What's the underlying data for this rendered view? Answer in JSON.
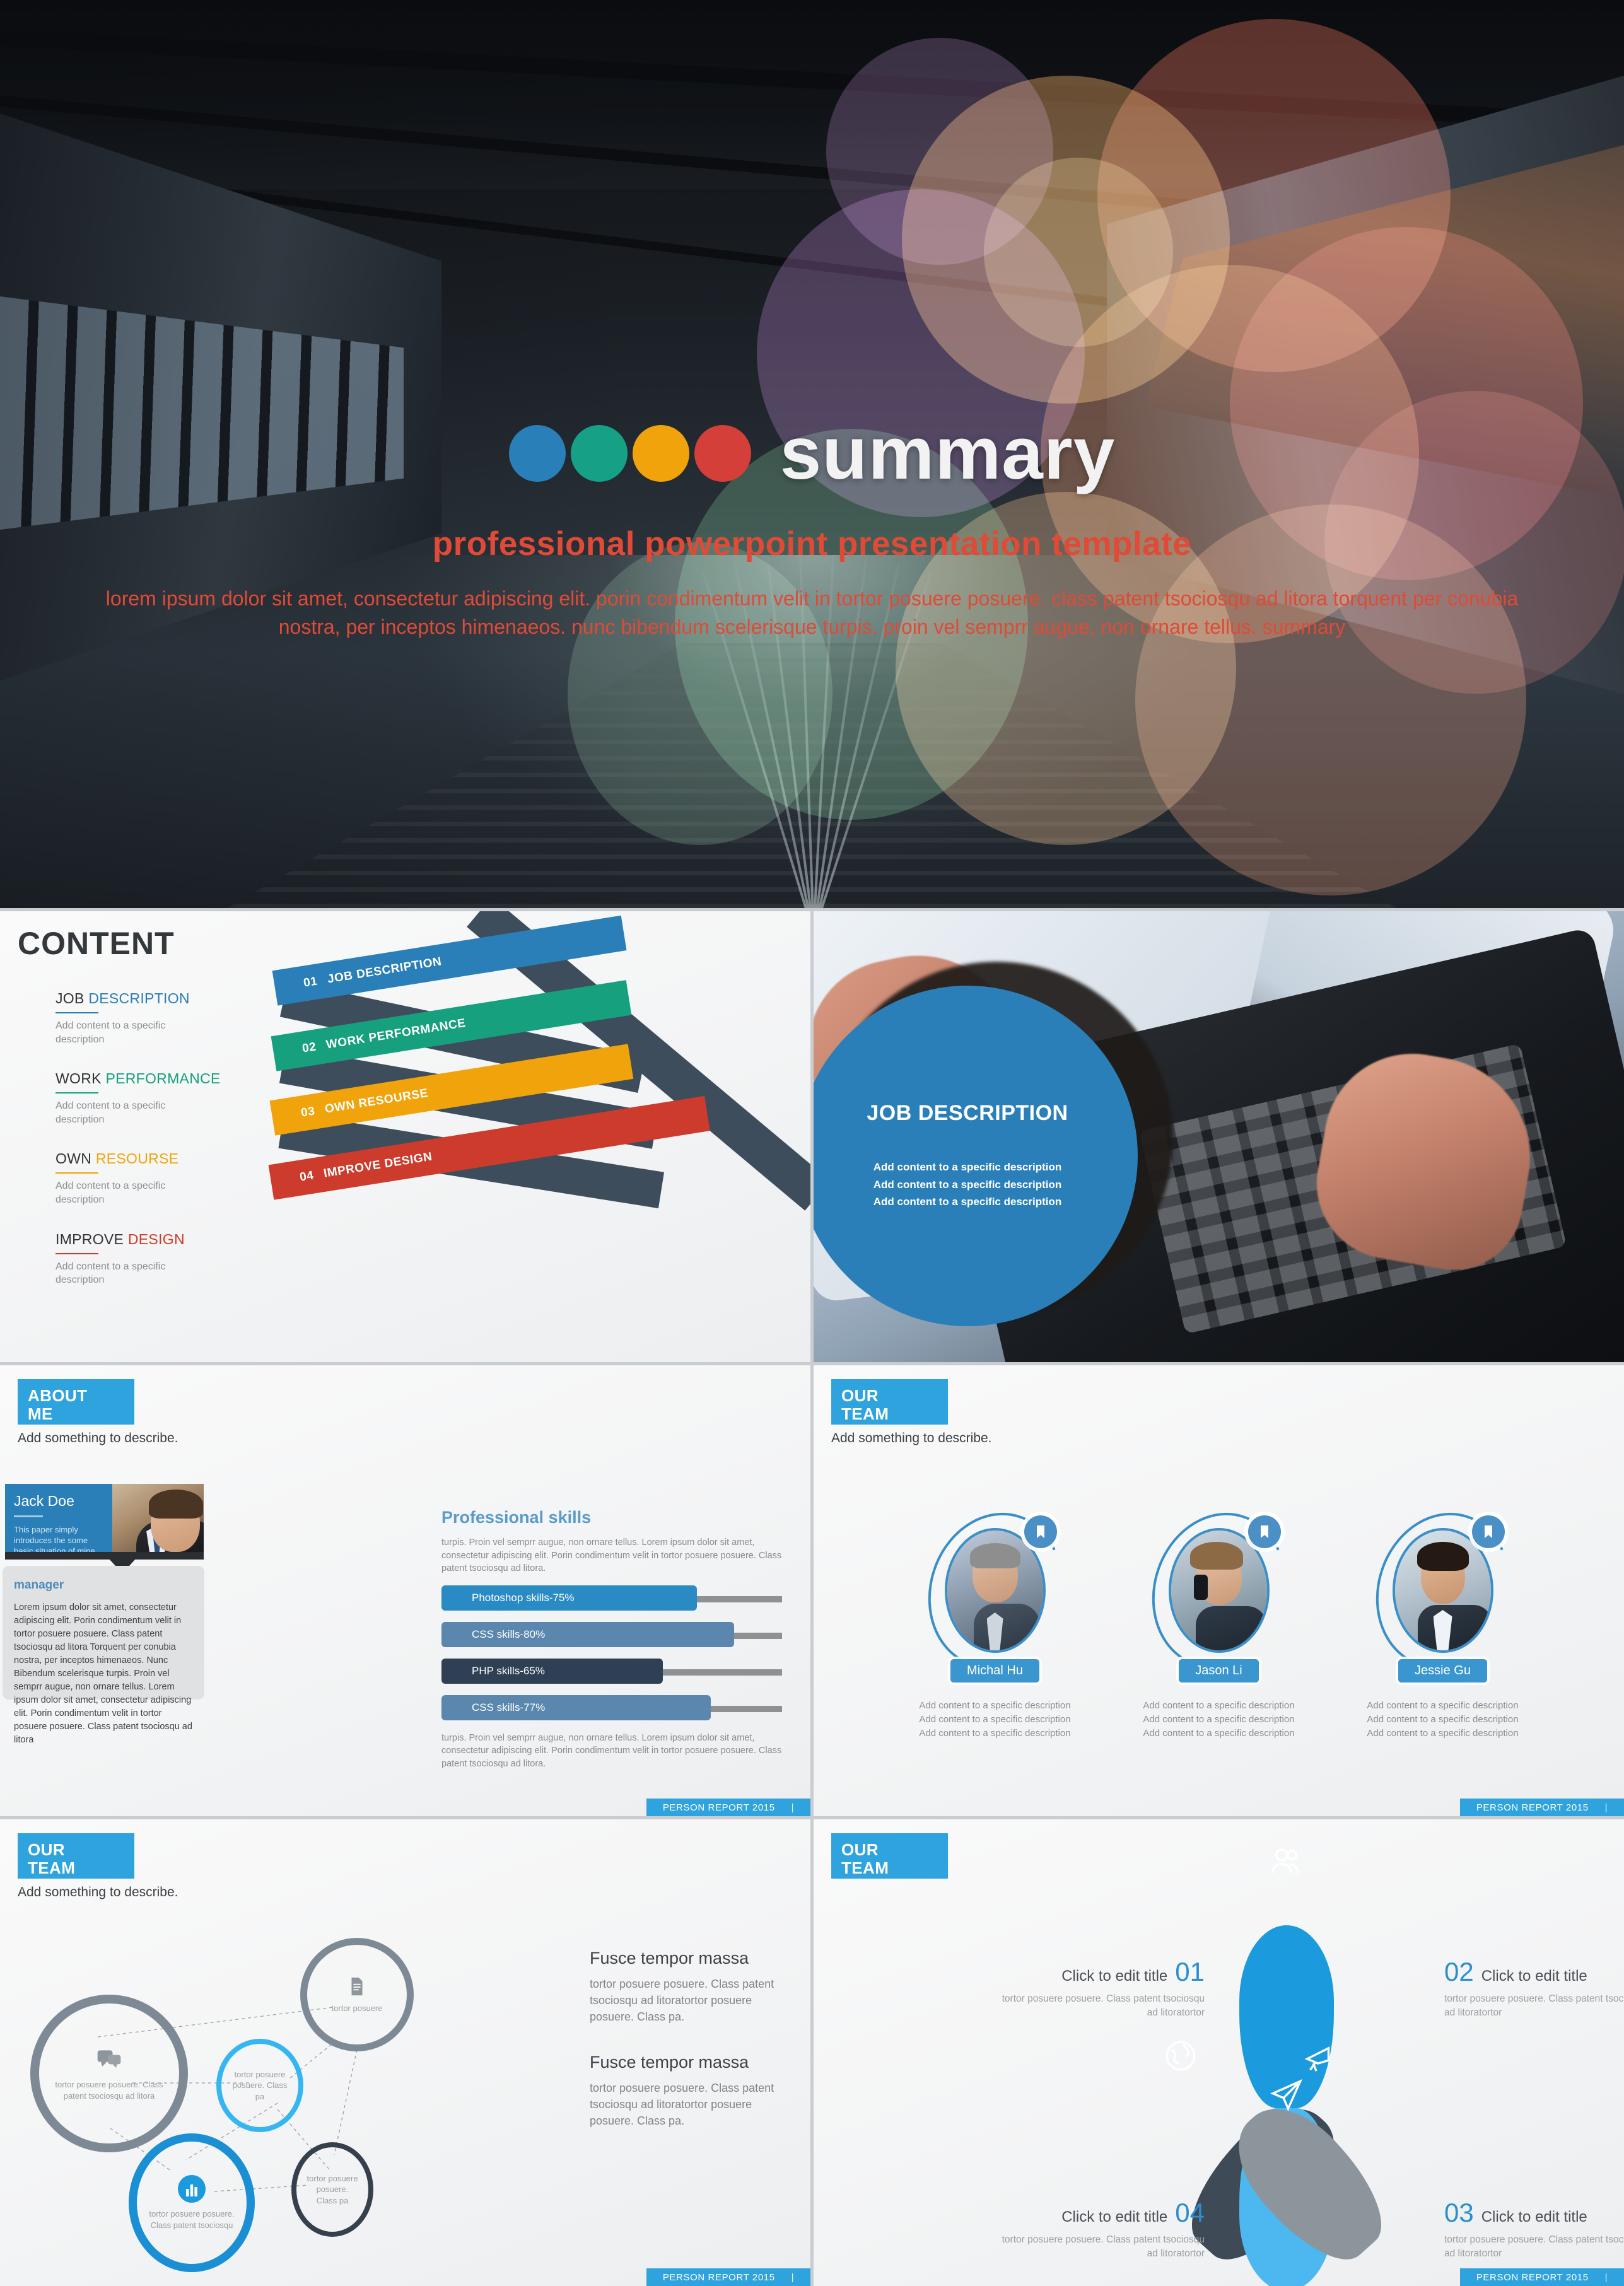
{
  "hero": {
    "title": "summary",
    "subtitle": "professional powerpoint presentation template",
    "description": "lorem ipsum dolor sit amet, consectetur adipiscing elit. porin condimentum velit in tortor posuere posuere. class patent tsociosqu ad litora torquent per conubia nostra, per inceptos himenaeos. nunc bibendum scelerisque turpis. proin vel semprr augue, non ornare tellus. summary",
    "dot_colors": [
      "#2980b9",
      "#16a085",
      "#f0a30a",
      "#d43f3a"
    ],
    "title_color": "#f2f2f2",
    "accent_color": "#e04a36"
  },
  "content_slide": {
    "title": "CONTENT",
    "items": [
      {
        "label_dark": "JOB",
        "label_accent": "DESCRIPTION",
        "color": "#2a7fb8",
        "desc": "Add content to a specific description"
      },
      {
        "label_dark": "WORK",
        "label_accent": "PERFORMANCE",
        "color": "#17a07e",
        "desc": "Add content to a specific description"
      },
      {
        "label_dark": "OWN",
        "label_accent": "RESOURSE",
        "color": "#f0a30a",
        "desc": "Add content to a specific description"
      },
      {
        "label_dark": "IMPROVE",
        "label_accent": "DESIGN",
        "color": "#cc3b2c",
        "desc": "Add content to a specific description"
      }
    ],
    "ribbons": [
      {
        "num": "01",
        "label": "JOB DESCRIPTION",
        "color": "#2a7fb8"
      },
      {
        "num": "02",
        "label": "WORK PERFORMANCE",
        "color": "#17a07e"
      },
      {
        "num": "03",
        "label": "OWN RESOURSE",
        "color": "#f0a30a"
      },
      {
        "num": "04",
        "label": "IMPROVE DESIGN",
        "color": "#cc3b2c"
      }
    ],
    "ribbon_band_color": "#3e4d5c"
  },
  "job_description_slide": {
    "title": "JOB DESCRIPTION",
    "lines": [
      "Add content to a specific description",
      "Add content to a specific description",
      "Add content to a specific description"
    ],
    "circle_color": "#2a7fb8"
  },
  "about_me_slide": {
    "heading_line1": "ABOUT",
    "heading_line2": "ME",
    "subtitle": "Add something to describe.",
    "person_name": "Jack Doe",
    "person_tagline": "This paper simply introduces the some basic situation of mine.",
    "role": "manager",
    "role_body": "Lorem ipsum dolor sit amet, consectetur adipiscing elit. Porin condimentum velit in tortor posuere posuere. Class patent tsociosqu ad litora Torquent per conubia nostra, per inceptos himenaeos. Nunc Bibendum scelerisque turpis. Proin vel semprr augue, non ornare tellus. Lorem ipsum dolor sit amet, consectetur adipiscing elit. Porin condimentum velit in tortor posuere posuere. Class patent tsociosqu ad litora",
    "skills_title": "Professional skills",
    "skills_note_top": "turpis. Proin vel semprr augue, non ornare tellus. Lorem ipsum dolor sit amet, consectetur adipiscing elit. Porin condimentum velit in tortor posuere posuere. Class patent tsociosqu ad litora.",
    "skills_note_bottom": "turpis. Proin vel semprr augue, non ornare tellus. Lorem ipsum dolor sit amet, consectetur adipiscing elit. Porin condimentum velit in tortor posuere posuere. Class patent tsociosqu ad litora.",
    "skills": [
      {
        "label": "Photoshop skills-75%",
        "value": 75,
        "color": "#2a8bc4"
      },
      {
        "label": "CSS skills-80%",
        "value": 80,
        "color": "#5b87ae"
      },
      {
        "label": "PHP skills-65%",
        "value": 65,
        "color": "#2f4054"
      },
      {
        "label": "CSS skills-77%",
        "value": 77,
        "color": "#5b87ae"
      }
    ],
    "footer": "PERSON REPORT 2015"
  },
  "team_slide": {
    "heading_line1": "OUR",
    "heading_line2": "TEAM",
    "subtitle": "Add something to describe.",
    "members": [
      {
        "name": "Michal Hu",
        "desc": "Add content to a specific description\nAdd content to a specific description\nAdd content to a specific description"
      },
      {
        "name": "Jason Li",
        "desc": "Add content to a specific description\nAdd content to a specific description\nAdd content to a specific description"
      },
      {
        "name": "Jessie Gu",
        "desc": "Add content to a specific description\nAdd content to a specific description\nAdd content to a specific description"
      }
    ],
    "footer": "PERSON REPORT 2015"
  },
  "network_slide": {
    "heading_line1": "OUR",
    "heading_line2": "TEAM",
    "subtitle": "Add something to describe.",
    "nodes": [
      {
        "text": "tortor posuere posuere. Class patent tsociosqu ad litora",
        "color": "#7d8a95",
        "icon": "chat-icon"
      },
      {
        "text": "tortor posuere",
        "color": "#7d8a95",
        "icon": "document-icon"
      },
      {
        "text": "tortor posuere posuere. Class pa",
        "color": "#35b6f0",
        "icon": ""
      },
      {
        "text": "tortor posuere posuere. Class patent tsociosqu",
        "color": "#1b8fd4",
        "icon": "chart-icon"
      },
      {
        "text": "tortor posuere posuere. Class pa",
        "color": "#36404c",
        "icon": ""
      }
    ],
    "blocks": [
      {
        "title": "Fusce tempor massa",
        "body": "tortor posuere posuere. Class patent tsociosqu ad litoratortor posuere posuere. Class pa."
      },
      {
        "title": "Fusce tempor massa",
        "body": "tortor posuere posuere. Class patent tsociosqu ad litoratortor posuere posuere. Class pa."
      }
    ],
    "footer": "PERSON REPORT 2015"
  },
  "petal_slide": {
    "heading_line1": "OUR",
    "heading_line2": "TEAM",
    "petals": [
      {
        "num": "01",
        "title": "Click to edit title",
        "body": "tortor posuere posuere. Class patent tsociosqu ad litoratortor",
        "color": "#8d959c",
        "icon": "globe-icon"
      },
      {
        "num": "02",
        "title": "Click to edit title",
        "body": "tortor posuere posuere. Class patent tsociosqu ad litoratortor",
        "color": "#1b9ade",
        "icon": "users-icon"
      },
      {
        "num": "03",
        "title": "Click to edit title",
        "body": "tortor posuere posuere. Class patent tsociosqu ad litoratortor",
        "color": "#3e4a56",
        "icon": "megaphone-icon"
      },
      {
        "num": "04",
        "title": "Click to edit title",
        "body": "tortor posuere posuere. Class patent tsociosqu ad litoratortor",
        "color": "#4db8ef",
        "icon": "paper-plane-icon"
      }
    ],
    "footer": "PERSON REPORT 2015"
  },
  "footer_bar": "|"
}
